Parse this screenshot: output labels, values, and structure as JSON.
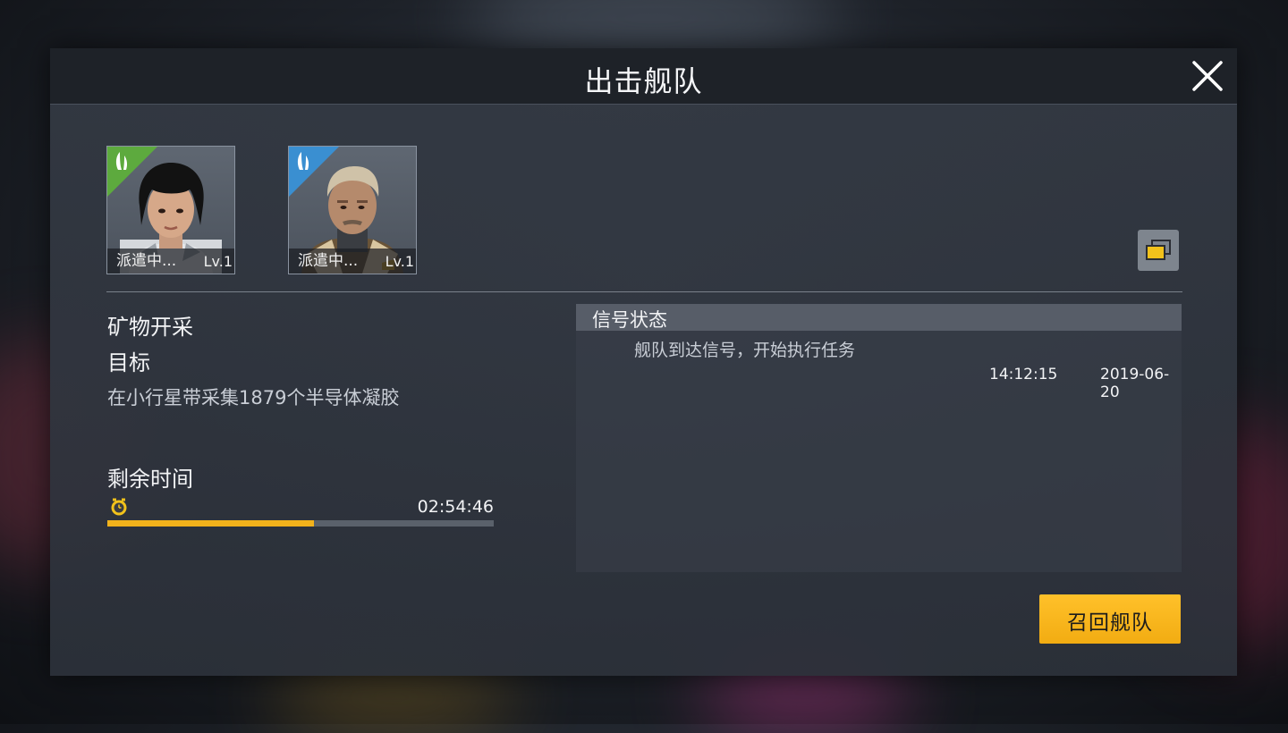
{
  "dialog": {
    "title": "出击舰队",
    "close_icon": "close-icon"
  },
  "fleet": {
    "heroes": [
      {
        "status": "派遣中...",
        "level": "Lv.1",
        "rarity_color": "#5daa3e",
        "portrait_icon": "female-pilot-portrait",
        "type_icon": "ship-type-icon"
      },
      {
        "status": "派遣中...",
        "level": "Lv.1",
        "rarity_color": "#3a8fd1",
        "portrait_icon": "male-captain-portrait",
        "type_icon": "ship-type-icon"
      }
    ],
    "switch_icon": "switch-view-icon"
  },
  "mission": {
    "name": "矿物开采",
    "goal_label": "目标",
    "goal_text": "在小行星带采集1879个半导体凝胶",
    "remaining_label": "剩余时间",
    "remaining_time": "02:54:46",
    "progress": 0.535,
    "progress_color": "#f2b21b",
    "clock_icon": "clock-icon"
  },
  "signal": {
    "title": "信号状态",
    "logs": [
      {
        "message": "舰队到达信号，开始执行任务",
        "time": "14:12:15",
        "date": "2019-06-20"
      }
    ]
  },
  "actions": {
    "recall_label": "召回舰队",
    "recall_color": "#ffc12a"
  }
}
